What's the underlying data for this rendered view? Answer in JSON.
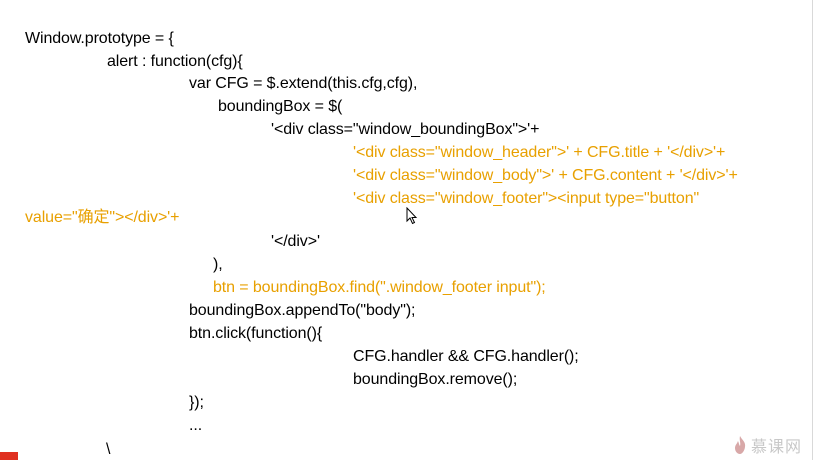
{
  "code": {
    "lines": [
      "Window.prototype = {",
      "alert : function(cfg){",
      "var CFG = $.extend(this.cfg,cfg),",
      "boundingBox = $(",
      "'<div class=\"window_boundingBox\">'+",
      "'<div class=\"window_header\">' + CFG.title + '</div>'+",
      "'<div class=\"window_body\">' + CFG.content + '</div>'+",
      "'<div class=\"window_footer\"><input type=\"button\"",
      "value=\"确定\"></div>'+",
      "'</div>'",
      "),",
      "btn = boundingBox.find(\".window_footer input\");",
      "boundingBox.appendTo(\"body\");",
      "btn.click(function(){",
      "CFG.handler && CFG.handler();",
      "boundingBox.remove();",
      "});",
      "...",
      "\\"
    ]
  },
  "watermark": {
    "text": "慕课网"
  },
  "colors": {
    "code_text": "#000000",
    "highlight": "#e8a000",
    "watermark": "#c8c8c8",
    "background": "#ffffff"
  }
}
